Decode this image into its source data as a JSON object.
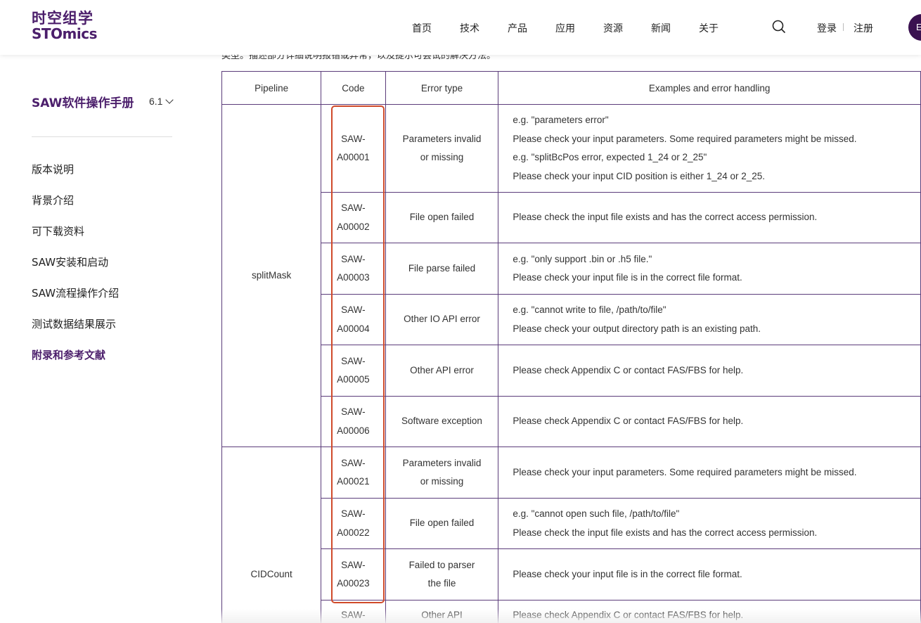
{
  "header": {
    "logo_cn": "时空组学",
    "logo_en": "STOmics",
    "nav": [
      "首页",
      "技术",
      "产品",
      "应用",
      "资源",
      "新闻",
      "关于"
    ],
    "login": "登录",
    "register": "注册",
    "lang": "E"
  },
  "intro_partial": "类型。描述部分详细说明报错或异常，以及提示可尝试的解决方法。",
  "sidebar": {
    "title": "SAW软件操作手册",
    "version": "6.1",
    "items": [
      {
        "label": "版本说明"
      },
      {
        "label": "背景介绍"
      },
      {
        "label": "可下载资料"
      },
      {
        "label": "SAW安装和启动"
      },
      {
        "label": "SAW流程操作介绍"
      },
      {
        "label": "测试数据结果展示"
      },
      {
        "label": "附录和参考文献"
      }
    ]
  },
  "table": {
    "headers": [
      "Pipeline",
      "Code",
      "Error type",
      "Examples and error handling"
    ],
    "groups": [
      {
        "pipeline": "splitMask",
        "rows": [
          {
            "code": [
              "SAW-",
              "A00001"
            ],
            "type": [
              "Parameters invalid",
              "or missing"
            ],
            "examples": [
              "e.g. \"parameters error\"",
              "Please check your input parameters. Some required parameters might be missed.",
              "e.g. \"splitBcPos error, expected 1_24 or 2_25\"",
              "Please check your input CID position is either 1_24 or 2_25."
            ]
          },
          {
            "code": [
              "SAW-",
              "A00002"
            ],
            "type": [
              "File open failed"
            ],
            "examples": [
              "Please check the input file exists and has the correct access permission."
            ]
          },
          {
            "code": [
              "SAW-",
              "A00003"
            ],
            "type": [
              "File parse failed"
            ],
            "examples": [
              "e.g. \"only support .bin or .h5 file.\"",
              "Please check your input file is in the correct file format."
            ]
          },
          {
            "code": [
              "SAW-",
              "A00004"
            ],
            "type": [
              "Other IO API error"
            ],
            "examples": [
              "e.g. \"cannot write to file, /path/to/file\"",
              "Please check your output directory path is an existing path."
            ]
          },
          {
            "code": [
              "SAW-",
              "A00005"
            ],
            "type": [
              "Other API error"
            ],
            "examples": [
              "Please check Appendix C or contact FAS/FBS for help."
            ]
          },
          {
            "code": [
              "SAW-",
              "A00006"
            ],
            "type": [
              "Software exception"
            ],
            "examples": [
              "Please check Appendix C or contact FAS/FBS for help."
            ]
          }
        ]
      },
      {
        "pipeline": "CIDCount",
        "rows": [
          {
            "code": [
              "SAW-",
              "A00021"
            ],
            "type": [
              "Parameters invalid",
              "or missing"
            ],
            "examples": [
              "Please check your input parameters. Some required parameters might be missed."
            ]
          },
          {
            "code": [
              "SAW-",
              "A00022"
            ],
            "type": [
              "File open failed"
            ],
            "examples": [
              "e.g. \"cannot open such file, /path/to/file\"",
              "Please check the input file exists and has the correct access permission."
            ]
          },
          {
            "code": [
              "SAW-",
              "A00023"
            ],
            "type": [
              "Failed to parser",
              "the file"
            ],
            "examples": [
              "Please check your input file is in the correct file format."
            ]
          },
          {
            "code": [
              "SAW-"
            ],
            "type": [
              "Other API"
            ],
            "examples": [
              "Please check Appendix C or contact FAS/FBS for help."
            ]
          }
        ]
      }
    ]
  },
  "colors": {
    "brand": "#4b1e6b",
    "table_border": "#5b3c7a",
    "highlight": "#d04a2a"
  }
}
